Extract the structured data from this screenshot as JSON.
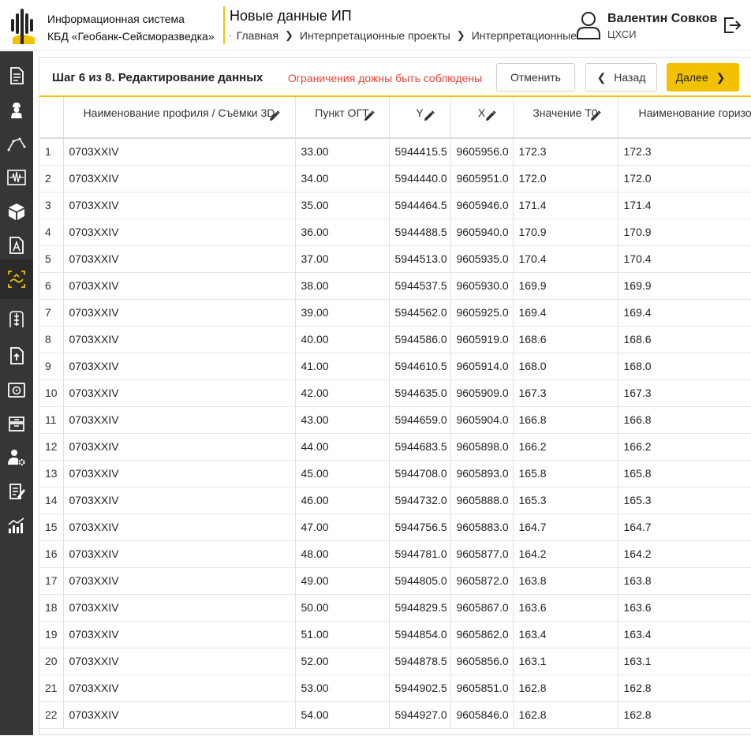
{
  "header": {
    "system_line1": "Информационная система",
    "system_line2": "КБД «Геобанк-Сейсморазведка»",
    "page_title": "Новые данные ИП",
    "breadcrumb": [
      "Главная",
      "Интерпретационные проекты",
      "Интерпретационные"
    ],
    "user_name": "Валентин Совков",
    "user_org": "ЦХСИ"
  },
  "sidebar": {
    "items": [
      "document-icon",
      "worker-icon",
      "profile-line-icon",
      "seismic-trace-icon",
      "cube-3d-icon",
      "document-chart-icon",
      "interpretation-icon",
      "well-icon",
      "document-upload-icon",
      "disk-drive-icon",
      "archive-icon",
      "user-settings-icon",
      "report-edit-icon",
      "statistics-icon"
    ],
    "active_index": 6
  },
  "step": {
    "title": "Шаг 6 из 8. Редактирование данных",
    "warning": "Ограничения дожны быть соблюдены",
    "cancel_label": "Отменить",
    "back_label": "Назад",
    "next_label": "Далее"
  },
  "table": {
    "columns": [
      "Наименование профиля / Съёмки 3D",
      "Пункт ОГТ",
      "Y",
      "X",
      "Значение Т0",
      "Наименование горизонта"
    ],
    "rows": [
      [
        "1",
        "0703XXIV",
        "33.00",
        "5944415.5",
        "9605956.0",
        "172.3",
        "172.3"
      ],
      [
        "2",
        "0703XXIV",
        "34.00",
        "5944440.0",
        "9605951.0",
        "172.0",
        "172.0"
      ],
      [
        "3",
        "0703XXIV",
        "35.00",
        "5944464.5",
        "9605946.0",
        "171.4",
        "171.4"
      ],
      [
        "4",
        "0703XXIV",
        "36.00",
        "5944488.5",
        "9605940.0",
        "170.9",
        "170.9"
      ],
      [
        "5",
        "0703XXIV",
        "37.00",
        "5944513.0",
        "9605935.0",
        "170.4",
        "170.4"
      ],
      [
        "6",
        "0703XXIV",
        "38.00",
        "5944537.5",
        "9605930.0",
        "169.9",
        "169.9"
      ],
      [
        "7",
        "0703XXIV",
        "39.00",
        "5944562.0",
        "9605925.0",
        "169.4",
        "169.4"
      ],
      [
        "8",
        "0703XXIV",
        "40.00",
        "5944586.0",
        "9605919.0",
        "168.6",
        "168.6"
      ],
      [
        "9",
        "0703XXIV",
        "41.00",
        "5944610.5",
        "9605914.0",
        "168.0",
        "168.0"
      ],
      [
        "10",
        "0703XXIV",
        "42.00",
        "5944635.0",
        "9605909.0",
        "167.3",
        "167.3"
      ],
      [
        "11",
        "0703XXIV",
        "43.00",
        "5944659.0",
        "9605904.0",
        "166.8",
        "166.8"
      ],
      [
        "12",
        "0703XXIV",
        "44.00",
        "5944683.5",
        "9605898.0",
        "166.2",
        "166.2"
      ],
      [
        "13",
        "0703XXIV",
        "45.00",
        "5944708.0",
        "9605893.0",
        "165.8",
        "165.8"
      ],
      [
        "14",
        "0703XXIV",
        "46.00",
        "5944732.0",
        "9605888.0",
        "165.3",
        "165.3"
      ],
      [
        "15",
        "0703XXIV",
        "47.00",
        "5944756.5",
        "9605883.0",
        "164.7",
        "164.7"
      ],
      [
        "16",
        "0703XXIV",
        "48.00",
        "5944781.0",
        "9605877.0",
        "164.2",
        "164.2"
      ],
      [
        "17",
        "0703XXIV",
        "49.00",
        "5944805.0",
        "9605872.0",
        "163.8",
        "163.8"
      ],
      [
        "18",
        "0703XXIV",
        "50.00",
        "5944829.5",
        "9605867.0",
        "163.6",
        "163.6"
      ],
      [
        "19",
        "0703XXIV",
        "51.00",
        "5944854.0",
        "9605862.0",
        "163.4",
        "163.4"
      ],
      [
        "20",
        "0703XXIV",
        "52.00",
        "5944878.5",
        "9605856.0",
        "163.1",
        "163.1"
      ],
      [
        "21",
        "0703XXIV",
        "53.00",
        "5944902.5",
        "9605851.0",
        "162.8",
        "162.8"
      ],
      [
        "22",
        "0703XXIV",
        "54.00",
        "5944927.0",
        "9605846.0",
        "162.8",
        "162.8"
      ]
    ]
  },
  "colors": {
    "accent": "#f2c200",
    "sidebar_bg": "#363636",
    "warning": "#e8443a"
  }
}
